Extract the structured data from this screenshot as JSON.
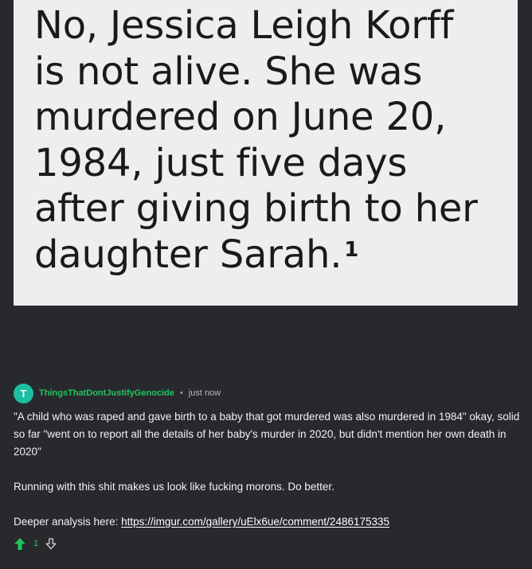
{
  "quote_image": {
    "text": "No, Jessica Leigh Korff\nis not alive. She was\nmurdered on June 20,\n1984, just five days\nafter giving birth to her\ndaughter Sarah.",
    "footnote": "1"
  },
  "comment": {
    "avatar_letter": "T",
    "username": "ThingsThatDontJustifyGenocide",
    "separator": "•",
    "timestamp": "just now",
    "paragraph_1": "\"A child who was raped and gave birth to a baby that got murdered was also murdered in 1984\" okay, solid so far \"went on to report all the details of her baby's murder in 2020, but didn't mention her own death in 2020\"",
    "paragraph_2": "Running with this shit makes us look like fucking morons. Do better.",
    "link_prefix": "Deeper analysis here: ",
    "link_text": "https://imgur.com/gallery/uElx6ue/comment/2486175335",
    "upvote_count": "1",
    "upvote_icon": "upvote-arrow-icon",
    "downvote_icon": "downvote-arrow-icon",
    "colors": {
      "accent_green": "#22c55e",
      "avatar_bg": "#1bbfa1",
      "background": "#27292d"
    }
  }
}
